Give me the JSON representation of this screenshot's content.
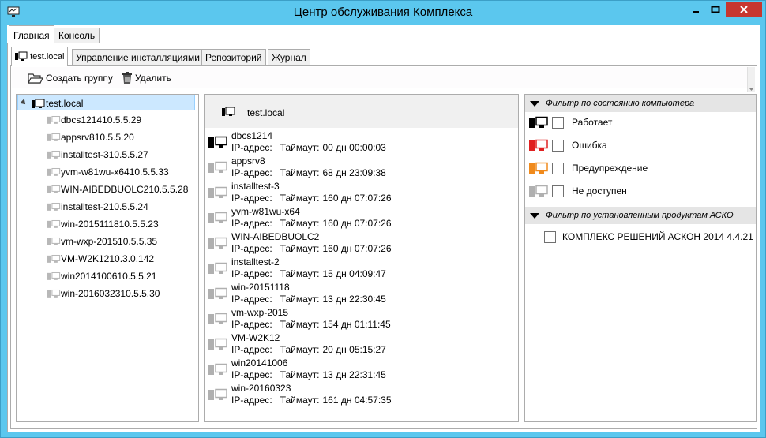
{
  "window": {
    "title": "Центр обслуживания Комплекса",
    "accent": "#5bc7ee",
    "close_color": "#c7372f"
  },
  "main_tabs": [
    {
      "label": "Главная",
      "active": true
    },
    {
      "label": "Консоль",
      "active": false
    }
  ],
  "sub_tabs": [
    {
      "label": "test.local",
      "active": true,
      "icon": "network-computer-icon"
    },
    {
      "label": "Управление инсталляциями",
      "active": false
    },
    {
      "label": "Репозиторий",
      "active": false
    },
    {
      "label": "Журнал",
      "active": false
    }
  ],
  "toolbar": {
    "create_group_label": "Создать группу",
    "create_group_icon": "folder-open-icon",
    "delete_label": "Удалить",
    "delete_icon": "trash-icon"
  },
  "tree": {
    "root_label": "test.local",
    "items": [
      "dbcs121410.5.5.29",
      "appsrv810.5.5.20",
      "installtest-310.5.5.27",
      "yvm-w81wu-x6410.5.5.33",
      "WIN-AIBEDBUOLC210.5.5.28",
      "installtest-210.5.5.24",
      "win-2015111810.5.5.23",
      "vm-wxp-201510.5.5.35",
      "VM-W2K1210.3.0.142",
      "win2014100610.5.5.21",
      "win-2016032310.5.5.30"
    ]
  },
  "list": {
    "header_label": "test.local",
    "ip_label": "IP-адрес:",
    "timeout_label": "Таймаут:",
    "items": [
      {
        "name": "dbcs1214",
        "timeout": "00 дн 00:00:03",
        "status": "online"
      },
      {
        "name": "appsrv8",
        "timeout": "68 дн 23:09:38",
        "status": "offline"
      },
      {
        "name": "installtest-3",
        "timeout": "160 дн 07:07:26",
        "status": "offline"
      },
      {
        "name": "yvm-w81wu-x64",
        "timeout": "160 дн 07:07:26",
        "status": "offline"
      },
      {
        "name": "WIN-AIBEDBUOLC2",
        "timeout": "160 дн 07:07:26",
        "status": "offline"
      },
      {
        "name": "installtest-2",
        "timeout": "15 дн 04:09:47",
        "status": "offline"
      },
      {
        "name": "win-20151118",
        "timeout": "13 дн 22:30:45",
        "status": "offline"
      },
      {
        "name": "vm-wxp-2015",
        "timeout": "154 дн 01:11:45",
        "status": "offline"
      },
      {
        "name": "VM-W2K12",
        "timeout": "20 дн 05:15:27",
        "status": "offline"
      },
      {
        "name": "win20141006",
        "timeout": "13 дн 22:31:45",
        "status": "offline"
      },
      {
        "name": "win-20160323",
        "timeout": "161 дн 04:57:35",
        "status": "offline"
      }
    ]
  },
  "filters": {
    "state_header": "Фильтр по состоянию компьютера",
    "states": [
      {
        "label": "Работает",
        "color": "#000000",
        "checked": false
      },
      {
        "label": "Ошибка",
        "color": "#e02020",
        "checked": false
      },
      {
        "label": "Предупреждение",
        "color": "#f08a1c",
        "checked": false
      },
      {
        "label": "Не доступен",
        "color": "#b0b0b0",
        "checked": false
      }
    ],
    "products_header": "Фильтр по установленным продуктам АСКО",
    "products": [
      {
        "label": "КОМПЛЕКС РЕШЕНИЙ АСКОН 2014 4.4.21",
        "checked": false
      }
    ]
  }
}
